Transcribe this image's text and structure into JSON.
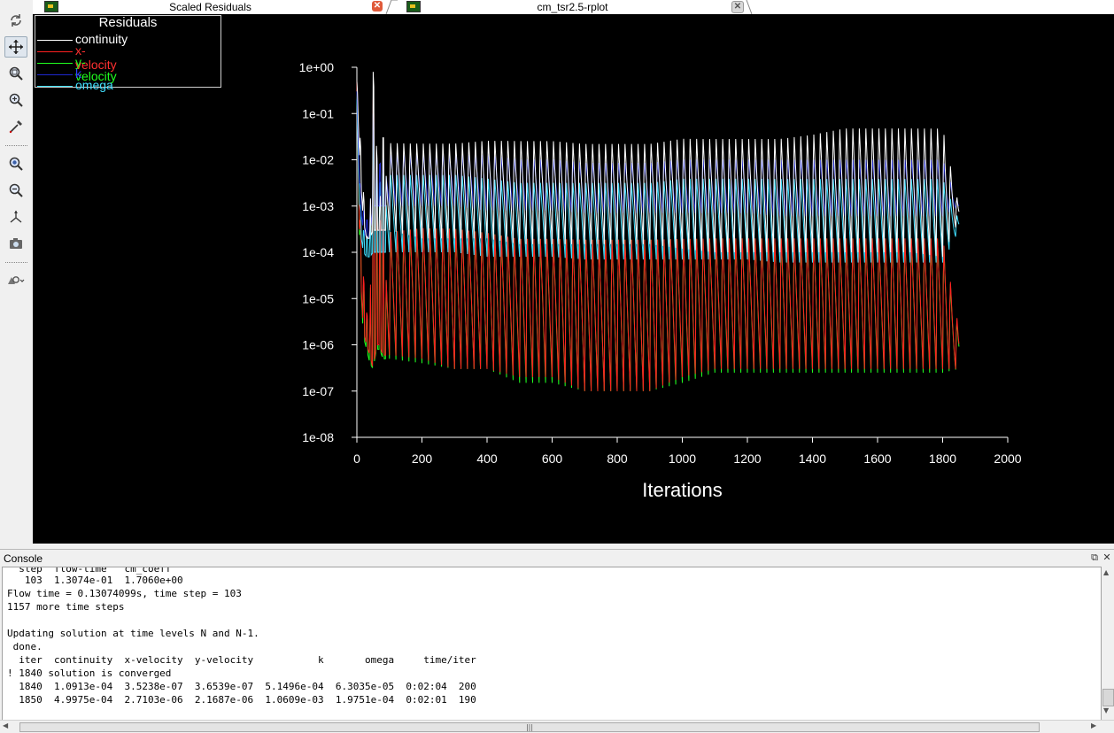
{
  "tabs": [
    {
      "label": "Scaled Residuals",
      "close": "✕"
    },
    {
      "label": "cm_tsr2.5-rplot",
      "close": "✕"
    }
  ],
  "toolbar": {
    "icons": [
      "refresh-icon",
      "move-icon",
      "zoom-fit-icon",
      "zoom-box-icon",
      "probe-icon",
      "zoom-in-icon",
      "zoom-out-icon",
      "axes-icon",
      "camera-icon",
      "view-options-icon"
    ]
  },
  "legend": {
    "title": "Residuals",
    "items": [
      {
        "label": "continuity",
        "color": "#ffffff"
      },
      {
        "label": "x-velocity",
        "color": "#ff2020"
      },
      {
        "label": "y-velocity",
        "color": "#20ff20"
      },
      {
        "label": "k",
        "color": "#1e28d0"
      },
      {
        "label": "omega",
        "color": "#40e0ff"
      }
    ]
  },
  "chart_data": {
    "type": "line",
    "xlabel": "Iterations",
    "ylabel": "",
    "xlim": [
      0,
      2000
    ],
    "ylim": [
      1e-08,
      1
    ],
    "yscale": "log",
    "xticks": [
      "0",
      "200",
      "400",
      "600",
      "800",
      "1000",
      "1200",
      "1400",
      "1600",
      "1800",
      "2000"
    ],
    "yticks": [
      "1e+00",
      "1e-01",
      "1e-02",
      "1e-03",
      "1e-04",
      "1e-05",
      "1e-06",
      "1e-07",
      "1e-08"
    ],
    "grid": false,
    "legend_position": "top-left",
    "period": 20,
    "series": [
      {
        "name": "continuity",
        "color": "#ffffff",
        "x": [
          0,
          10,
          20,
          30,
          40,
          50,
          60,
          70,
          80,
          100,
          200,
          300,
          400,
          500,
          600,
          700,
          800,
          900,
          1000,
          1100,
          1200,
          1300,
          1400,
          1500,
          1600,
          1700,
          1800,
          1850
        ],
        "peak": [
          0.5,
          0.03,
          0.002,
          0.0002,
          0.0003,
          0.8,
          0.02,
          0.0008,
          0.03,
          0.03,
          0.03,
          0.03,
          0.035,
          0.035,
          0.035,
          0.03,
          0.03,
          0.03,
          0.04,
          0.04,
          0.04,
          0.04,
          0.05,
          0.07,
          0.07,
          0.07,
          0.07,
          0.001
        ],
        "trough": [
          0.5,
          0.005,
          0.0005,
          0.0002,
          0.0002,
          0.0003,
          0.0003,
          0.0003,
          0.0003,
          0.0003,
          0.0002,
          0.0002,
          0.0002,
          0.00015,
          0.00015,
          0.00015,
          0.00015,
          0.00015,
          0.00012,
          0.0001,
          0.0001,
          0.0001,
          0.0001,
          0.0001,
          0.0001,
          0.0001,
          8e-05,
          0.0005
        ]
      },
      {
        "name": "x-velocity",
        "color": "#ff2020",
        "x": [
          0,
          10,
          20,
          30,
          40,
          50,
          60,
          70,
          80,
          100,
          200,
          300,
          400,
          500,
          600,
          700,
          800,
          900,
          1000,
          1100,
          1200,
          1300,
          1400,
          1500,
          1600,
          1700,
          1800,
          1850
        ],
        "peak": [
          0.5,
          0.0005,
          3e-05,
          5e-06,
          2e-06,
          0.2,
          0.005,
          0.0005,
          0.0003,
          0.0004,
          0.0005,
          0.0005,
          0.0004,
          0.0003,
          0.0003,
          0.0003,
          0.0003,
          0.0003,
          0.0003,
          0.0003,
          0.0003,
          0.0003,
          0.0003,
          0.0003,
          0.0003,
          0.0003,
          0.0003,
          2.5e-06
        ],
        "trough": [
          0.5,
          5e-05,
          2e-06,
          1e-06,
          6e-07,
          3e-07,
          1e-06,
          1e-06,
          6e-07,
          6e-07,
          5e-07,
          3e-07,
          3e-07,
          2e-07,
          2e-07,
          1e-07,
          1e-07,
          1e-07,
          2e-07,
          3e-07,
          3e-07,
          3e-07,
          3e-07,
          3e-07,
          3e-07,
          3e-07,
          3e-07,
          3e-07
        ]
      },
      {
        "name": "y-velocity",
        "color": "#20ff20",
        "x": [
          0,
          10,
          20,
          30,
          40,
          50,
          60,
          70,
          80,
          100,
          200,
          300,
          400,
          500,
          600,
          700,
          800,
          900,
          1000,
          1100,
          1200,
          1300,
          1400,
          1500,
          1600,
          1700,
          1800,
          1850
        ],
        "peak": [
          0.3,
          0.0003,
          2e-05,
          4e-06,
          2e-06,
          0.1,
          0.003,
          0.0003,
          0.0003,
          0.0004,
          0.0005,
          0.0005,
          0.0004,
          0.0003,
          0.0003,
          0.0003,
          0.0003,
          0.0003,
          0.0003,
          0.0003,
          0.0003,
          0.0003,
          0.0003,
          0.0003,
          0.0003,
          0.0003,
          0.0003,
          2e-06
        ],
        "trough": [
          0.3,
          4e-05,
          1.5e-06,
          8e-07,
          4e-07,
          3e-07,
          8e-07,
          8e-07,
          5e-07,
          5e-07,
          4e-07,
          3e-07,
          3e-07,
          1.5e-07,
          1.5e-07,
          1e-07,
          1e-07,
          1e-07,
          1.5e-07,
          2.5e-07,
          2.5e-07,
          2.5e-07,
          2.5e-07,
          2.5e-07,
          2.5e-07,
          2.5e-07,
          2.5e-07,
          3e-07
        ]
      },
      {
        "name": "k",
        "color": "#1e28d0",
        "x": [
          0,
          10,
          20,
          30,
          40,
          50,
          60,
          70,
          80,
          100,
          200,
          300,
          400,
          500,
          600,
          700,
          800,
          900,
          1000,
          1100,
          1200,
          1300,
          1400,
          1500,
          1600,
          1700,
          1800,
          1850
        ],
        "peak": [
          0.3,
          0.003,
          0.0008,
          0.0005,
          0.0005,
          0.1,
          0.01,
          0.008,
          0.01,
          0.015,
          0.015,
          0.015,
          0.015,
          0.012,
          0.012,
          0.01,
          0.01,
          0.01,
          0.012,
          0.012,
          0.012,
          0.012,
          0.012,
          0.012,
          0.012,
          0.012,
          0.012,
          0.001
        ],
        "trough": [
          0.3,
          0.001,
          0.0003,
          0.0002,
          0.0002,
          0.001,
          0.001,
          0.001,
          0.001,
          0.001,
          0.001,
          0.001,
          0.0008,
          0.0008,
          0.0008,
          0.0007,
          0.0007,
          0.0007,
          0.0007,
          0.0007,
          0.0007,
          0.0006,
          0.0006,
          0.0006,
          0.0006,
          0.0006,
          0.0006,
          0.001
        ]
      },
      {
        "name": "omega",
        "color": "#40e0ff",
        "x": [
          0,
          10,
          20,
          30,
          40,
          50,
          60,
          70,
          80,
          100,
          200,
          300,
          400,
          500,
          600,
          700,
          800,
          900,
          1000,
          1100,
          1200,
          1300,
          1400,
          1500,
          1600,
          1700,
          1800,
          1850
        ],
        "peak": [
          0.2,
          0.001,
          0.0003,
          0.0002,
          0.0002,
          0.05,
          0.005,
          0.003,
          0.005,
          0.006,
          0.006,
          0.006,
          0.005,
          0.004,
          0.004,
          0.004,
          0.004,
          0.004,
          0.005,
          0.005,
          0.005,
          0.005,
          0.005,
          0.005,
          0.005,
          0.005,
          0.005,
          0.0005
        ],
        "trough": [
          0.2,
          0.0003,
          0.0001,
          8e-05,
          8e-05,
          0.0001,
          0.0001,
          0.0001,
          0.0001,
          0.0001,
          0.0001,
          0.0001,
          8e-05,
          8e-05,
          8e-05,
          7e-05,
          7e-05,
          7e-05,
          7e-05,
          7e-05,
          7e-05,
          6e-05,
          6e-05,
          6e-05,
          6e-05,
          6e-05,
          6e-05,
          0.0003
        ]
      }
    ]
  },
  "console": {
    "title": "Console",
    "restore_icon": "⧉",
    "close_icon": "✕",
    "lines": [
      "  step  flow-time   cm_coeff",
      "   103  1.3074e-01  1.7060e+00",
      "Flow time = 0.13074099s, time step = 103",
      "1157 more time steps",
      "",
      "Updating solution at time levels N and N-1.",
      " done.",
      "  iter  continuity  x-velocity  y-velocity           k       omega     time/iter",
      "! 1840 solution is converged",
      "  1840  1.0913e-04  3.5238e-07  3.6539e-07  5.1496e-04  6.3035e-05  0:02:04  200",
      "  1850  4.9975e-04  2.7103e-06  2.1687e-06  1.0609e-03  1.9751e-04  0:02:01  190"
    ]
  },
  "scrollbars": {
    "h_grip": "|||",
    "up": "▲",
    "down": "▼",
    "left": "◀",
    "right": "▶"
  }
}
